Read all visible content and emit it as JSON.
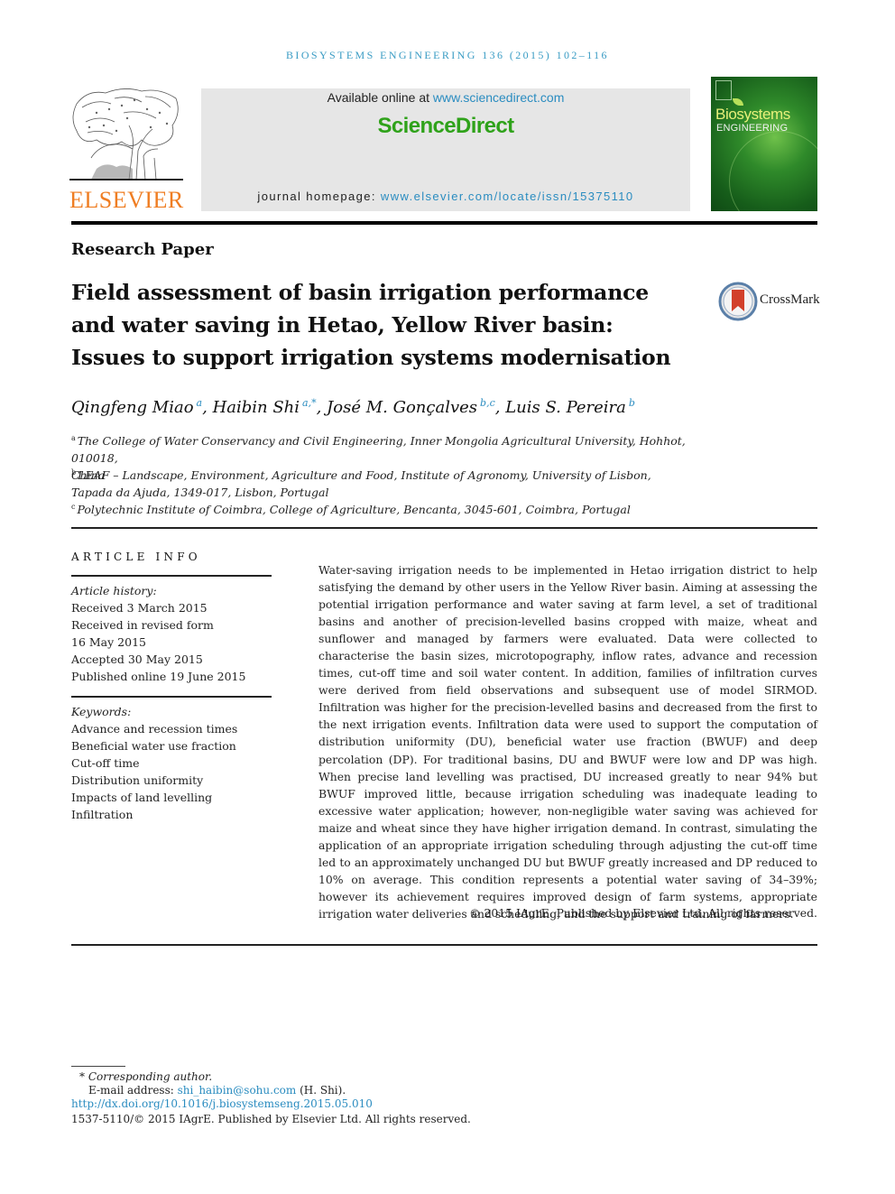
{
  "running_head": "BIOSYSTEMS ENGINEERING 136 (2015) 102–116",
  "publisher": {
    "logo_word": "ELSEVIER",
    "available_online_prefix": "Available online at ",
    "available_online_link": "www.sciencedirect.com",
    "brand": "ScienceDirect",
    "homepage_prefix": "journal homepage: ",
    "homepage_link": "www.elsevier.com/locate/issn/15375110",
    "brand_color": "#2fa21a",
    "link_color": "#2a8cc0",
    "elsevier_color": "#ef7d22"
  },
  "cover": {
    "title_line1": "Biosystems",
    "title_line2": "ENGINEERING"
  },
  "article_type": "Research Paper",
  "title_lines": [
    "Field assessment of basin irrigation performance",
    "and water saving in Hetao, Yellow River basin:",
    "Issues to support irrigation systems modernisation"
  ],
  "crossmark": {
    "label": "CrossMark",
    "icon": "crossmark-icon"
  },
  "authors": [
    {
      "name": "Qingfeng Miao",
      "sup": "a",
      "sep": ", "
    },
    {
      "name": "Haibin Shi",
      "sup": "a,*",
      "sep": ", "
    },
    {
      "name": "José M. Gonçalves",
      "sup": "b,c",
      "sep": ", "
    },
    {
      "name": "Luis S. Pereira",
      "sup": "b",
      "sep": ""
    }
  ],
  "affiliations": [
    {
      "key": "a",
      "lines": [
        "The College of Water Conservancy and Civil Engineering, Inner Mongolia Agricultural University, Hohhot, 010018,",
        "China"
      ]
    },
    {
      "key": "b",
      "lines": [
        "LEAF – Landscape, Environment, Agriculture and Food, Institute of Agronomy, University of Lisbon,",
        "Tapada da Ajuda, 1349-017, Lisbon, Portugal"
      ]
    },
    {
      "key": "c",
      "lines": [
        "Polytechnic Institute of Coimbra, College of Agriculture, Bencanta, 3045-601, Coimbra, Portugal"
      ]
    }
  ],
  "article_info": {
    "heading": "ARTICLE INFO",
    "history_label": "Article history:",
    "history": [
      "Received 3 March 2015",
      "Received in revised form",
      "16 May 2015",
      "Accepted 30 May 2015",
      "Published online 19 June 2015"
    ],
    "keywords_label": "Keywords:",
    "keywords": [
      "Advance and recession times",
      "Beneficial water use fraction",
      "Cut-off time",
      "Distribution uniformity",
      "Impacts of land levelling",
      "Infiltration"
    ]
  },
  "abstract": {
    "text": "Water-saving irrigation needs to be implemented in Hetao irrigation district to help satisfying the demand by other users in the Yellow River basin. Aiming at assessing the potential irrigation performance and water saving at farm level, a set of traditional basins and another of precision-levelled basins cropped with maize, wheat and sunflower and managed by farmers were evaluated. Data were collected to characterise the basin sizes, microtopography, inflow rates, advance and recession times, cut-off time and soil water content. In addition, families of infiltration curves were derived from field observations and subsequent use of model SIRMOD. Infiltration was higher for the precision-levelled basins and decreased from the first to the next irrigation events. Infiltration data were used to support the computation of distribution uniformity (DU), beneficial water use fraction (BWUF) and deep percolation (DP). For traditional basins, DU and BWUF were low and DP was high. When precise land levelling was practised, DU increased greatly to near 94% but BWUF improved little, because irrigation scheduling was inadequate leading to excessive water application; however, non-negligible water saving was achieved for maize and wheat since they have higher irrigation demand. In contrast, simulating the application of an appropriate irrigation scheduling through adjusting the cut-off time led to an approximately unchanged DU but BWUF greatly increased and DP reduced to 10% on average. This condition represents a potential water saving of 34–39%; however its achievement requires improved design of farm systems, appropriate irrigation water deliveries and scheduling, and the support and training of farmers.",
    "copyright": "© 2015 IAgrE. Published by Elsevier Ltd. All rights reserved."
  },
  "footnotes": {
    "corresponding_mark": "*",
    "corresponding_label": "Corresponding author.",
    "email_label": "E-mail address: ",
    "email": "shi_haibin@sohu.com",
    "email_suffix": " (H. Shi).",
    "doi": "http://dx.doi.org/10.1016/j.biosystemseng.2015.05.010",
    "issn_line": "1537-5110/© 2015 IAgrE. Published by Elsevier Ltd. All rights reserved."
  }
}
